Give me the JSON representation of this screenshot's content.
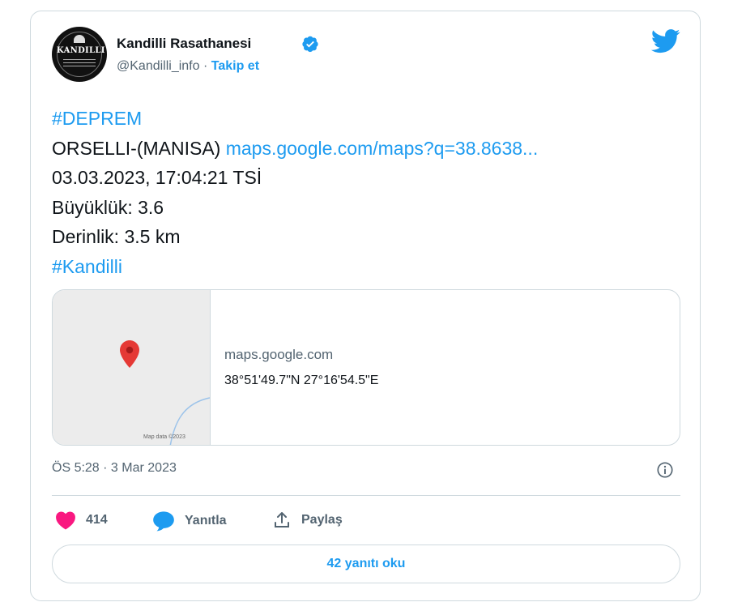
{
  "tweet": {
    "author": {
      "name": "Kandilli Rasathanesi",
      "handle": "@Kandilli_info",
      "separator": " · ",
      "follow_label": "Takip et",
      "avatar_logo_text": "KANDILLI"
    },
    "body": {
      "hashtag_1": "#DEPREM",
      "location": "ORSELLI-(MANISA) ",
      "map_link": "maps.google.com/maps?q=38.8638...",
      "datetime": "03.03.2023, 17:04:21 TSİ",
      "magnitude": "Büyüklük: 3.6",
      "depth": "Derinlik: 3.5 km",
      "hashtag_2": "#Kandilli"
    },
    "link_card": {
      "domain": "maps.google.com",
      "coordinates": "38°51'49.7\"N 27°16'54.5\"E",
      "map_attribution": "Map data ©2023"
    },
    "timestamp": "ÖS 5:28 · 3 Mar 2023",
    "actions": {
      "like_count": "414",
      "reply_label": "Yanıtla",
      "share_label": "Paylaş"
    },
    "read_replies_label": "42 yanıtı oku"
  },
  "colors": {
    "accent": "#1d9bf0",
    "like": "#f91880",
    "map_pin": "#e53935",
    "text_secondary": "#536471",
    "border": "#cfd9de"
  },
  "icons": [
    "twitter-bird-icon",
    "verified-badge-icon",
    "map-pin-icon",
    "info-icon",
    "heart-icon",
    "reply-bubble-icon",
    "share-icon"
  ]
}
